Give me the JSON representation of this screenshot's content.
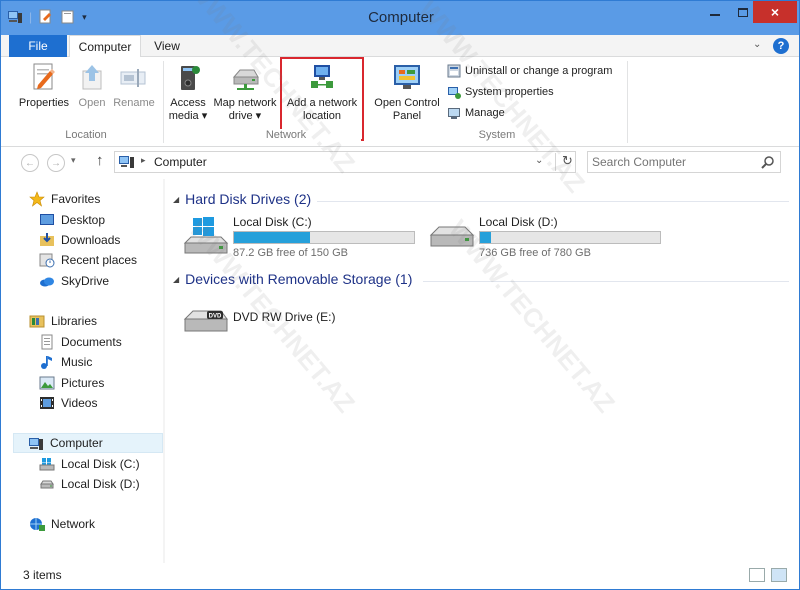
{
  "window": {
    "title": "Computer"
  },
  "title_controls": {
    "close_glyph": "×"
  },
  "ribbon_tabs": [
    {
      "label": "File"
    },
    {
      "label": "Computer"
    },
    {
      "label": "View"
    }
  ],
  "ribbon": {
    "location": {
      "label": "Location",
      "buttons": [
        {
          "label": "Properties",
          "icon": "properties-icon"
        },
        {
          "label": "Open",
          "icon": "open-icon"
        },
        {
          "label": "Rename",
          "icon": "rename-icon"
        }
      ]
    },
    "network": {
      "label": "Network",
      "access_media": {
        "line1": "Access",
        "line2": "media ▾"
      },
      "map_drive": {
        "line1": "Map network",
        "line2": "drive ▾"
      },
      "add_location": {
        "line1": "Add a network",
        "line2": "location"
      }
    },
    "control_panel": {
      "line1": "Open Control",
      "line2": "Panel"
    },
    "system": {
      "label": "System",
      "items": [
        {
          "label": "Uninstall or change a program",
          "icon": "uninstall-icon"
        },
        {
          "label": "System properties",
          "icon": "system-properties-icon"
        },
        {
          "label": "Manage",
          "icon": "manage-icon"
        }
      ]
    }
  },
  "address": {
    "crumb": "Computer",
    "search_placeholder": "Search Computer"
  },
  "nav": {
    "favorites": {
      "label": "Favorites",
      "items": [
        {
          "label": "Desktop"
        },
        {
          "label": "Downloads"
        },
        {
          "label": "Recent places"
        },
        {
          "label": "SkyDrive"
        }
      ]
    },
    "libraries": {
      "label": "Libraries",
      "items": [
        {
          "label": "Documents"
        },
        {
          "label": "Music"
        },
        {
          "label": "Pictures"
        },
        {
          "label": "Videos"
        }
      ]
    },
    "computer": {
      "label": "Computer",
      "items": [
        {
          "label": "Local Disk (C:)"
        },
        {
          "label": "Local Disk (D:)"
        }
      ]
    },
    "network": {
      "label": "Network"
    }
  },
  "content": {
    "hard_disks": {
      "header": "Hard Disk Drives (2)",
      "drives": [
        {
          "name": "Local Disk (C:)",
          "free": "87.2 GB free of 150 GB",
          "used_fraction": 0.42
        },
        {
          "name": "Local Disk (D:)",
          "free": "736 GB free of 780 GB",
          "used_fraction": 0.06
        }
      ]
    },
    "removable": {
      "header": "Devices with Removable Storage (1)",
      "drives": [
        {
          "name": "DVD RW Drive (E:)",
          "badge": "DVD"
        }
      ]
    }
  },
  "status": {
    "count": "3 items"
  },
  "watermark": "WWW.TECHNET.AZ",
  "colors": {
    "titlebar": "#5a9be6",
    "file_tab": "#1e6fd0",
    "close": "#c7302b",
    "drive_bar": "#26a0da",
    "highlight": "#d9272e"
  }
}
